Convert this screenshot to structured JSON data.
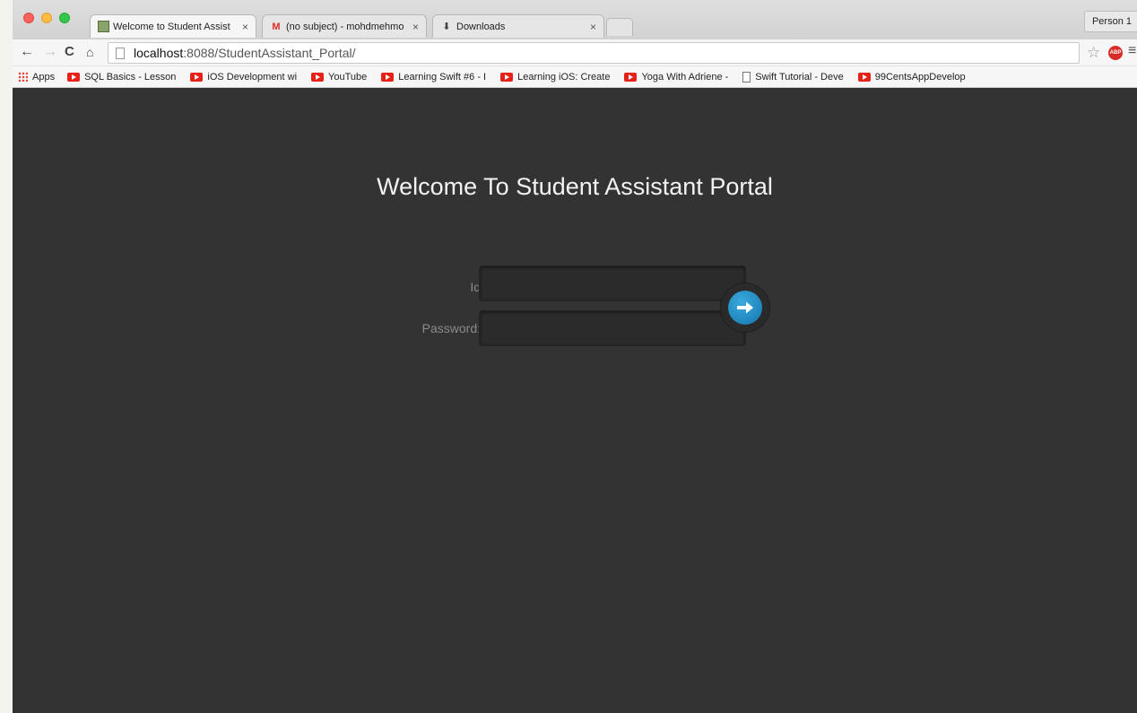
{
  "browser": {
    "tabs": [
      {
        "title": "Welcome to Student Assist",
        "close": "×",
        "active": true
      },
      {
        "title": "(no subject) - mohdmehmo",
        "close": "×",
        "active": false
      },
      {
        "title": "Downloads",
        "close": "×",
        "active": false
      }
    ],
    "profile": "Person 1",
    "url_host": "localhost",
    "url_rest": ":8088/StudentAssistant_Portal/",
    "icons": {
      "back": "←",
      "forward": "→",
      "reload": "C",
      "home": "⌂",
      "star": "☆",
      "menu": "≡",
      "download": "⬇",
      "gmail": "M",
      "adblock": "ABP"
    }
  },
  "bookmarks": [
    {
      "label": "Apps",
      "icon": "apps-grid"
    },
    {
      "label": "SQL Basics - Lesson",
      "icon": "youtube"
    },
    {
      "label": "iOS Development wi",
      "icon": "youtube"
    },
    {
      "label": "YouTube",
      "icon": "youtube"
    },
    {
      "label": "Learning Swift #6 - I",
      "icon": "youtube"
    },
    {
      "label": "Learning iOS: Create",
      "icon": "youtube"
    },
    {
      "label": "Yoga With Adriene -",
      "icon": "youtube"
    },
    {
      "label": "Swift Tutorial - Deve",
      "icon": "document"
    },
    {
      "label": "99CentsAppDevelop",
      "icon": "youtube"
    }
  ],
  "page": {
    "heading": "Welcome To Student Assistant Portal",
    "id_label": "Id",
    "password_label": "Password:",
    "id_value": "",
    "password_value": "",
    "submit_icon": "➜"
  },
  "colors": {
    "page_background": "#333333",
    "submit_button": "#1f86bd",
    "heading_text": "#f2f2f2"
  }
}
